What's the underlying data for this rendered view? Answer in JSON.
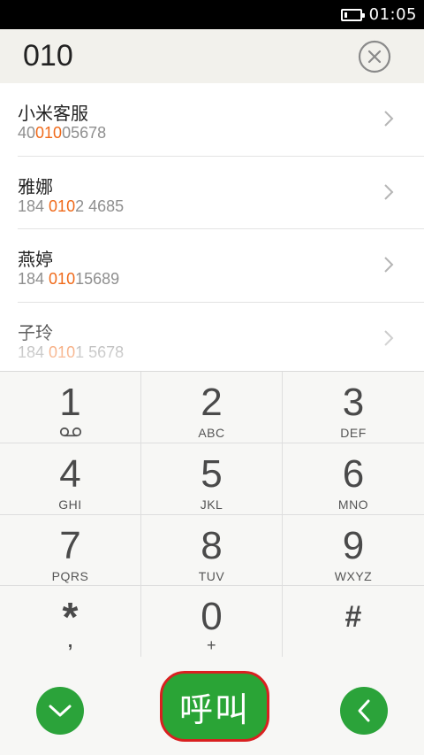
{
  "status_bar": {
    "time": "01:05",
    "battery_level": 0.15,
    "battery_icon": "battery-icon"
  },
  "dialer": {
    "dialed_number": "010",
    "clear_icon": "clear-circle-icon"
  },
  "results": [
    {
      "name": "小米客服",
      "number_pre": "40",
      "number_match": "010",
      "number_post": "05678"
    },
    {
      "name": "雅娜",
      "number_pre": "184 ",
      "number_match": "010",
      "number_post": "2 4685"
    },
    {
      "name": "燕婷",
      "number_pre": "184 ",
      "number_match": "010",
      "number_post": "15689"
    },
    {
      "name": "子玲",
      "number_pre": "184 ",
      "number_match": "010",
      "number_post": "1 5678"
    }
  ],
  "keypad": [
    {
      "digit": "1",
      "letters": "",
      "icon": "voicemail-icon"
    },
    {
      "digit": "2",
      "letters": "ABC"
    },
    {
      "digit": "3",
      "letters": "DEF"
    },
    {
      "digit": "4",
      "letters": "GHI"
    },
    {
      "digit": "5",
      "letters": "JKL"
    },
    {
      "digit": "6",
      "letters": "MNO"
    },
    {
      "digit": "7",
      "letters": "PQRS"
    },
    {
      "digit": "8",
      "letters": "TUV"
    },
    {
      "digit": "9",
      "letters": "WXYZ"
    },
    {
      "digit": "*",
      "letters": ","
    },
    {
      "digit": "0",
      "letters": "+"
    },
    {
      "digit": "#",
      "letters": ""
    }
  ],
  "actions": {
    "call_label": "呼叫",
    "hide_icon": "chevron-down-icon",
    "back_icon": "chevron-left-icon"
  },
  "colors": {
    "accent_green": "#2aa436",
    "match_orange": "#f06a1a",
    "call_border": "#d92020"
  }
}
